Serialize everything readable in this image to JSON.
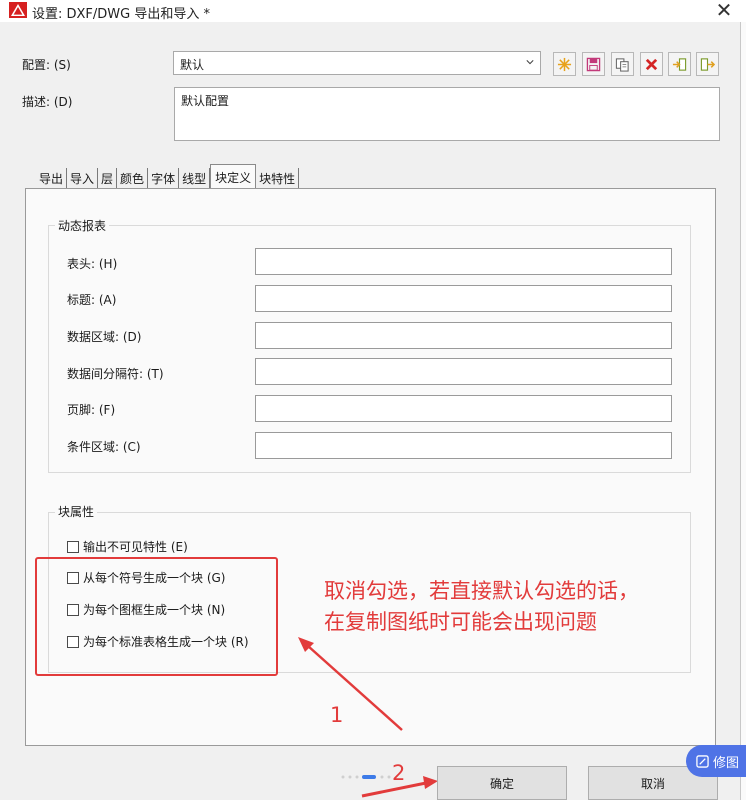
{
  "window": {
    "title": "设置: DXF/DWG 导出和导入 *",
    "close_glyph": "✕"
  },
  "config": {
    "label": "配置: (S)",
    "value": "默认",
    "toolbar_icons": [
      "new-star-icon",
      "save-icon",
      "copy-icon",
      "delete-icon",
      "import-icon",
      "export-icon"
    ]
  },
  "description": {
    "label": "描述: (D)",
    "value": "默认配置"
  },
  "tabs": [
    "导出",
    "导入",
    "层",
    "颜色",
    "字体",
    "线型",
    "块定义",
    "块特性"
  ],
  "active_tab": "块定义",
  "dynamic_report": {
    "title": "动态报表",
    "fields": [
      {
        "label": "表头: (H)",
        "value": ""
      },
      {
        "label": "标题: (A)",
        "value": ""
      },
      {
        "label": "数据区域: (D)",
        "value": ""
      },
      {
        "label": "数据间分隔符: (T)",
        "value": ""
      },
      {
        "label": "页脚: (F)",
        "value": ""
      },
      {
        "label": "条件区域: (C)",
        "value": ""
      }
    ]
  },
  "block_attributes": {
    "title": "块属性",
    "checkboxes": [
      {
        "label": "输出不可见特性 (E)",
        "checked": false
      },
      {
        "label": "从每个符号生成一个块 (G)",
        "checked": false
      },
      {
        "label": "为每个图框生成一个块 (N)",
        "checked": false
      },
      {
        "label": "为每个标准表格生成一个块 (R)",
        "checked": false
      }
    ]
  },
  "annotation": {
    "line1": "取消勾选，若直接默认勾选的话，",
    "line2": "在复制图纸时可能会出现问题",
    "step1": "1",
    "step2": "2",
    "color": "#e23b3b"
  },
  "buttons": {
    "ok": "确定",
    "cancel": "取消"
  },
  "overlay": {
    "label": "修图"
  }
}
